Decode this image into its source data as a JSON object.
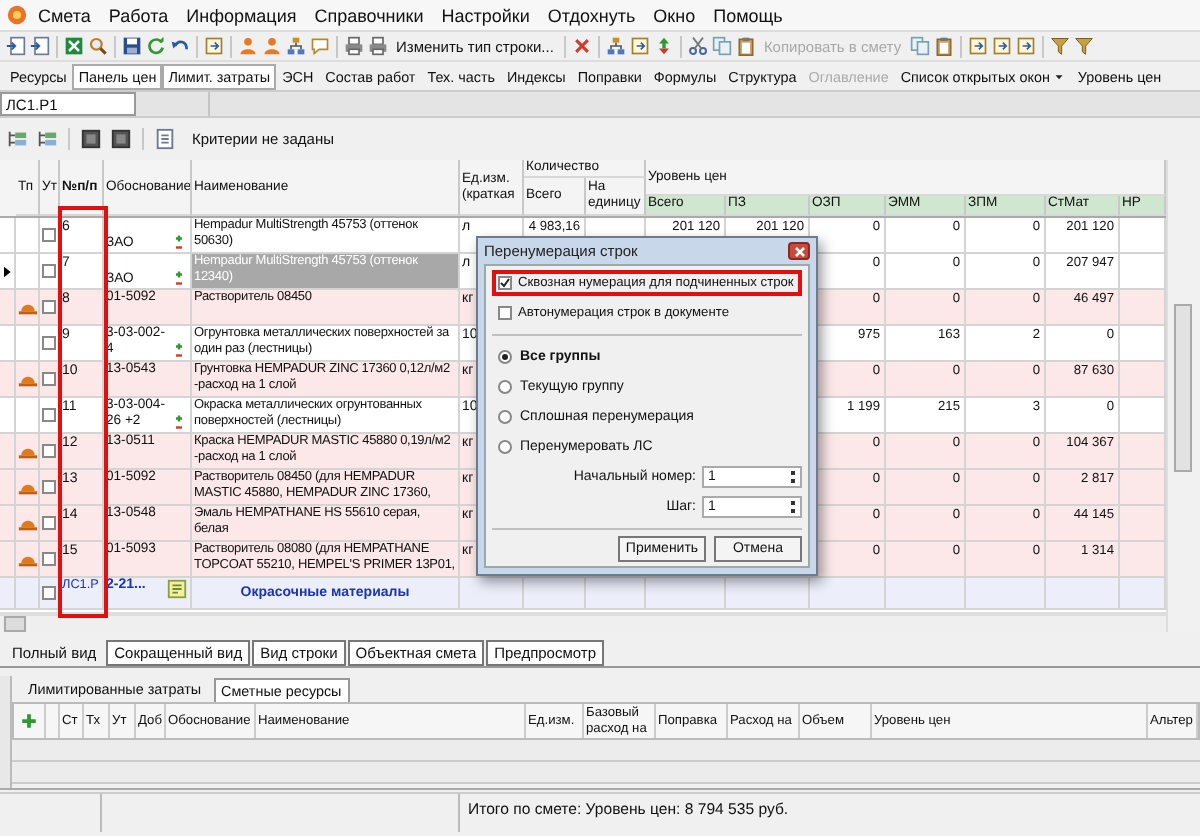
{
  "menu": [
    "Смета",
    "Работа",
    "Информация",
    "Справочники",
    "Настройки",
    "Отдохнуть",
    "Окно",
    "Помощь"
  ],
  "toolbar": {
    "buttons": [
      {
        "label": "Изменить тип строки...",
        "disabled": false
      },
      {
        "label": "Копировать в смету",
        "disabled": true
      }
    ]
  },
  "panels": [
    {
      "label": "Ресурсы",
      "kind": "button",
      "pressed": false,
      "disabled": false
    },
    {
      "label": "Панель цен",
      "kind": "button",
      "pressed": true,
      "disabled": false
    },
    {
      "label": "Лимит. затраты",
      "kind": "button",
      "pressed": true,
      "disabled": false
    },
    {
      "label": "ЭСН",
      "kind": "button",
      "pressed": false,
      "disabled": false
    },
    {
      "label": "Состав работ",
      "kind": "button",
      "pressed": false,
      "disabled": false
    },
    {
      "label": "Тех. часть",
      "kind": "button",
      "pressed": false,
      "disabled": false
    },
    {
      "label": "Индексы",
      "kind": "button",
      "pressed": false,
      "disabled": false
    },
    {
      "label": "Поправки",
      "kind": "button",
      "pressed": false,
      "disabled": false
    },
    {
      "label": "Формулы",
      "kind": "button",
      "pressed": false,
      "disabled": false
    },
    {
      "label": "Структура",
      "kind": "button",
      "pressed": false,
      "disabled": false
    },
    {
      "label": "Оглавление",
      "kind": "button",
      "pressed": false,
      "disabled": true
    },
    {
      "label": "Список открытых окон",
      "kind": "dropdown",
      "pressed": false,
      "disabled": false
    },
    {
      "label": "Уровень цен",
      "kind": "button",
      "pressed": false,
      "disabled": false
    }
  ],
  "address": "ЛС1.Р1",
  "filter": {
    "text": "Критерии не заданы"
  },
  "table": {
    "columns": [
      {
        "label": "Тп",
        "highlighted": false
      },
      {
        "label": "Ут",
        "highlighted": false
      },
      {
        "label": "№п/п",
        "highlighted": true
      },
      {
        "label": "Обоснование",
        "highlighted": false
      },
      {
        "label": "Наименование",
        "highlighted": false
      },
      {
        "label": "Ед.изм. (краткая",
        "highlighted": false
      }
    ],
    "quantity_group": {
      "label": "Количество",
      "columns": [
        "Всего",
        "На единицу"
      ]
    },
    "price_group": {
      "label": "Уровень цен",
      "columns": [
        "Всего",
        "ПЗ",
        "ОЗП",
        "ЭММ",
        "ЗПМ",
        "СтМат",
        "НР"
      ]
    },
    "rows": [
      {
        "kind": "item",
        "selected": false,
        "checked": false,
        "num": "6",
        "code": "ЗАО",
        "name": "Hempadur MultiStrength 45753 (оттенок 50630)",
        "unit": "л",
        "qty": "4 983,16",
        "total": "201 120",
        "pz": "201 120",
        "ozp": "0",
        "emm": "0",
        "zpm": "0",
        "stmat": "201 120"
      },
      {
        "kind": "item",
        "selected": true,
        "checked": false,
        "num": "7",
        "code": "ЗАО",
        "name": "Hempadur MultiStrength 45753 (оттенок 12340)",
        "unit": "л",
        "ozp": "0",
        "emm": "0",
        "zpm": "0",
        "stmat": "207 947"
      },
      {
        "kind": "resource",
        "selected": false,
        "checked": false,
        "num": "8",
        "code": "01-5092",
        "name": "Растворитель 08450",
        "unit": "кг",
        "ozp": "0",
        "emm": "0",
        "zpm": "0",
        "stmat": "46 497"
      },
      {
        "kind": "work",
        "selected": false,
        "checked": false,
        "num": "9",
        "code": "3-03-002-4",
        "name": "Огрунтовка металлических поверхностей за один раз (лестницы)",
        "unit": "10",
        "ozp": "975",
        "emm": "163",
        "zpm": "2",
        "stmat": "0"
      },
      {
        "kind": "resource",
        "selected": false,
        "checked": false,
        "num": "10",
        "code": "13-0543",
        "name": "Грунтовка HEMPADUR ZINC 17360 0,12л/м2 -расход на 1 слой",
        "unit": "кг",
        "ozp": "0",
        "emm": "0",
        "zpm": "0",
        "stmat": "87 630"
      },
      {
        "kind": "work",
        "selected": false,
        "checked": false,
        "num": "11",
        "code": "3-03-004-26 +2",
        "name": "Окраска металлических огрунтованных поверхностей (лестницы)",
        "unit": "10",
        "ozp": "1 199",
        "emm": "215",
        "zpm": "3",
        "stmat": "0"
      },
      {
        "kind": "resource",
        "selected": false,
        "checked": false,
        "num": "12",
        "code": "13-0511",
        "name": "Краска HEMPADUR MASTIC 45880 0,19л/м2 -расход на 1 слой",
        "unit": "кг",
        "ozp": "0",
        "emm": "0",
        "zpm": "0",
        "stmat": "104 367"
      },
      {
        "kind": "resource",
        "selected": false,
        "checked": false,
        "num": "13",
        "code": "01-5092",
        "name": "Растворитель 08450 (для HEMPADUR MASTIC 45880, HEMPADUR ZINC 17360,",
        "unit": "кг",
        "ozp": "0",
        "emm": "0",
        "zpm": "0",
        "stmat": "2 817"
      },
      {
        "kind": "resource",
        "selected": false,
        "checked": false,
        "num": "14",
        "code": "13-0548",
        "name": "Эмаль HEMPATHANE HS 55610 серая, белая",
        "unit": "кг",
        "ozp": "0",
        "emm": "0",
        "zpm": "0",
        "stmat": "44 145"
      },
      {
        "kind": "resource",
        "selected": false,
        "checked": false,
        "num": "15",
        "code": "01-5093",
        "name": "Растворитель 08080 (для HEMPATHANE TOPCOAT 55210, HEMPEL'S PRIMER 13P01,",
        "unit": "кг",
        "ozp": "0",
        "emm": "0",
        "zpm": "0",
        "stmat": "1 314"
      },
      {
        "kind": "section",
        "selected": false,
        "checked": false,
        "num": "ЛС1.Р",
        "code": "2-21...",
        "name": "Окрасочные материалы"
      }
    ]
  },
  "dialog": {
    "title": "Перенумерация строк",
    "options": [
      {
        "label": "Сквозная нумерация для подчиненных строк",
        "checked": true,
        "highlighted": true
      },
      {
        "label": "Автонумерация строк в документе",
        "checked": false,
        "highlighted": false
      }
    ],
    "scopes": [
      {
        "label": "Все группы",
        "selected": true
      },
      {
        "label": "Текущую группу",
        "selected": false
      },
      {
        "label": "Сплошная перенумерация",
        "selected": false
      },
      {
        "label": "Перенумеровать ЛС",
        "selected": false
      }
    ],
    "fields": [
      {
        "label": "Начальный номер:",
        "value": "1"
      },
      {
        "label": "Шаг:",
        "value": "1"
      }
    ],
    "buttons": [
      "Применить",
      "Отмена"
    ]
  },
  "view_tabs": [
    {
      "label": "Полный вид",
      "selected": true
    },
    {
      "label": "Сокращенный вид",
      "selected": false
    },
    {
      "label": "Вид строки",
      "selected": false
    },
    {
      "label": "Объектная смета",
      "selected": false
    },
    {
      "label": "Предпросмотр",
      "selected": false
    }
  ],
  "lower_panel": {
    "tabs": [
      {
        "label": "Лимитированные затраты",
        "selected": false
      },
      {
        "label": "Сметные ресурсы",
        "selected": true
      }
    ],
    "columns": [
      "Ст",
      "Тх",
      "Ут",
      "Доб",
      "Обоснование",
      "Наименование",
      "Ед.изм.",
      "Базовый расход на",
      "Поправка",
      "Расход на",
      "Объем",
      "Уровень цен",
      "Альтер"
    ]
  },
  "status_bar": {
    "total": "Итого по смете: Уровень цен: 8 794 535 руб."
  }
}
